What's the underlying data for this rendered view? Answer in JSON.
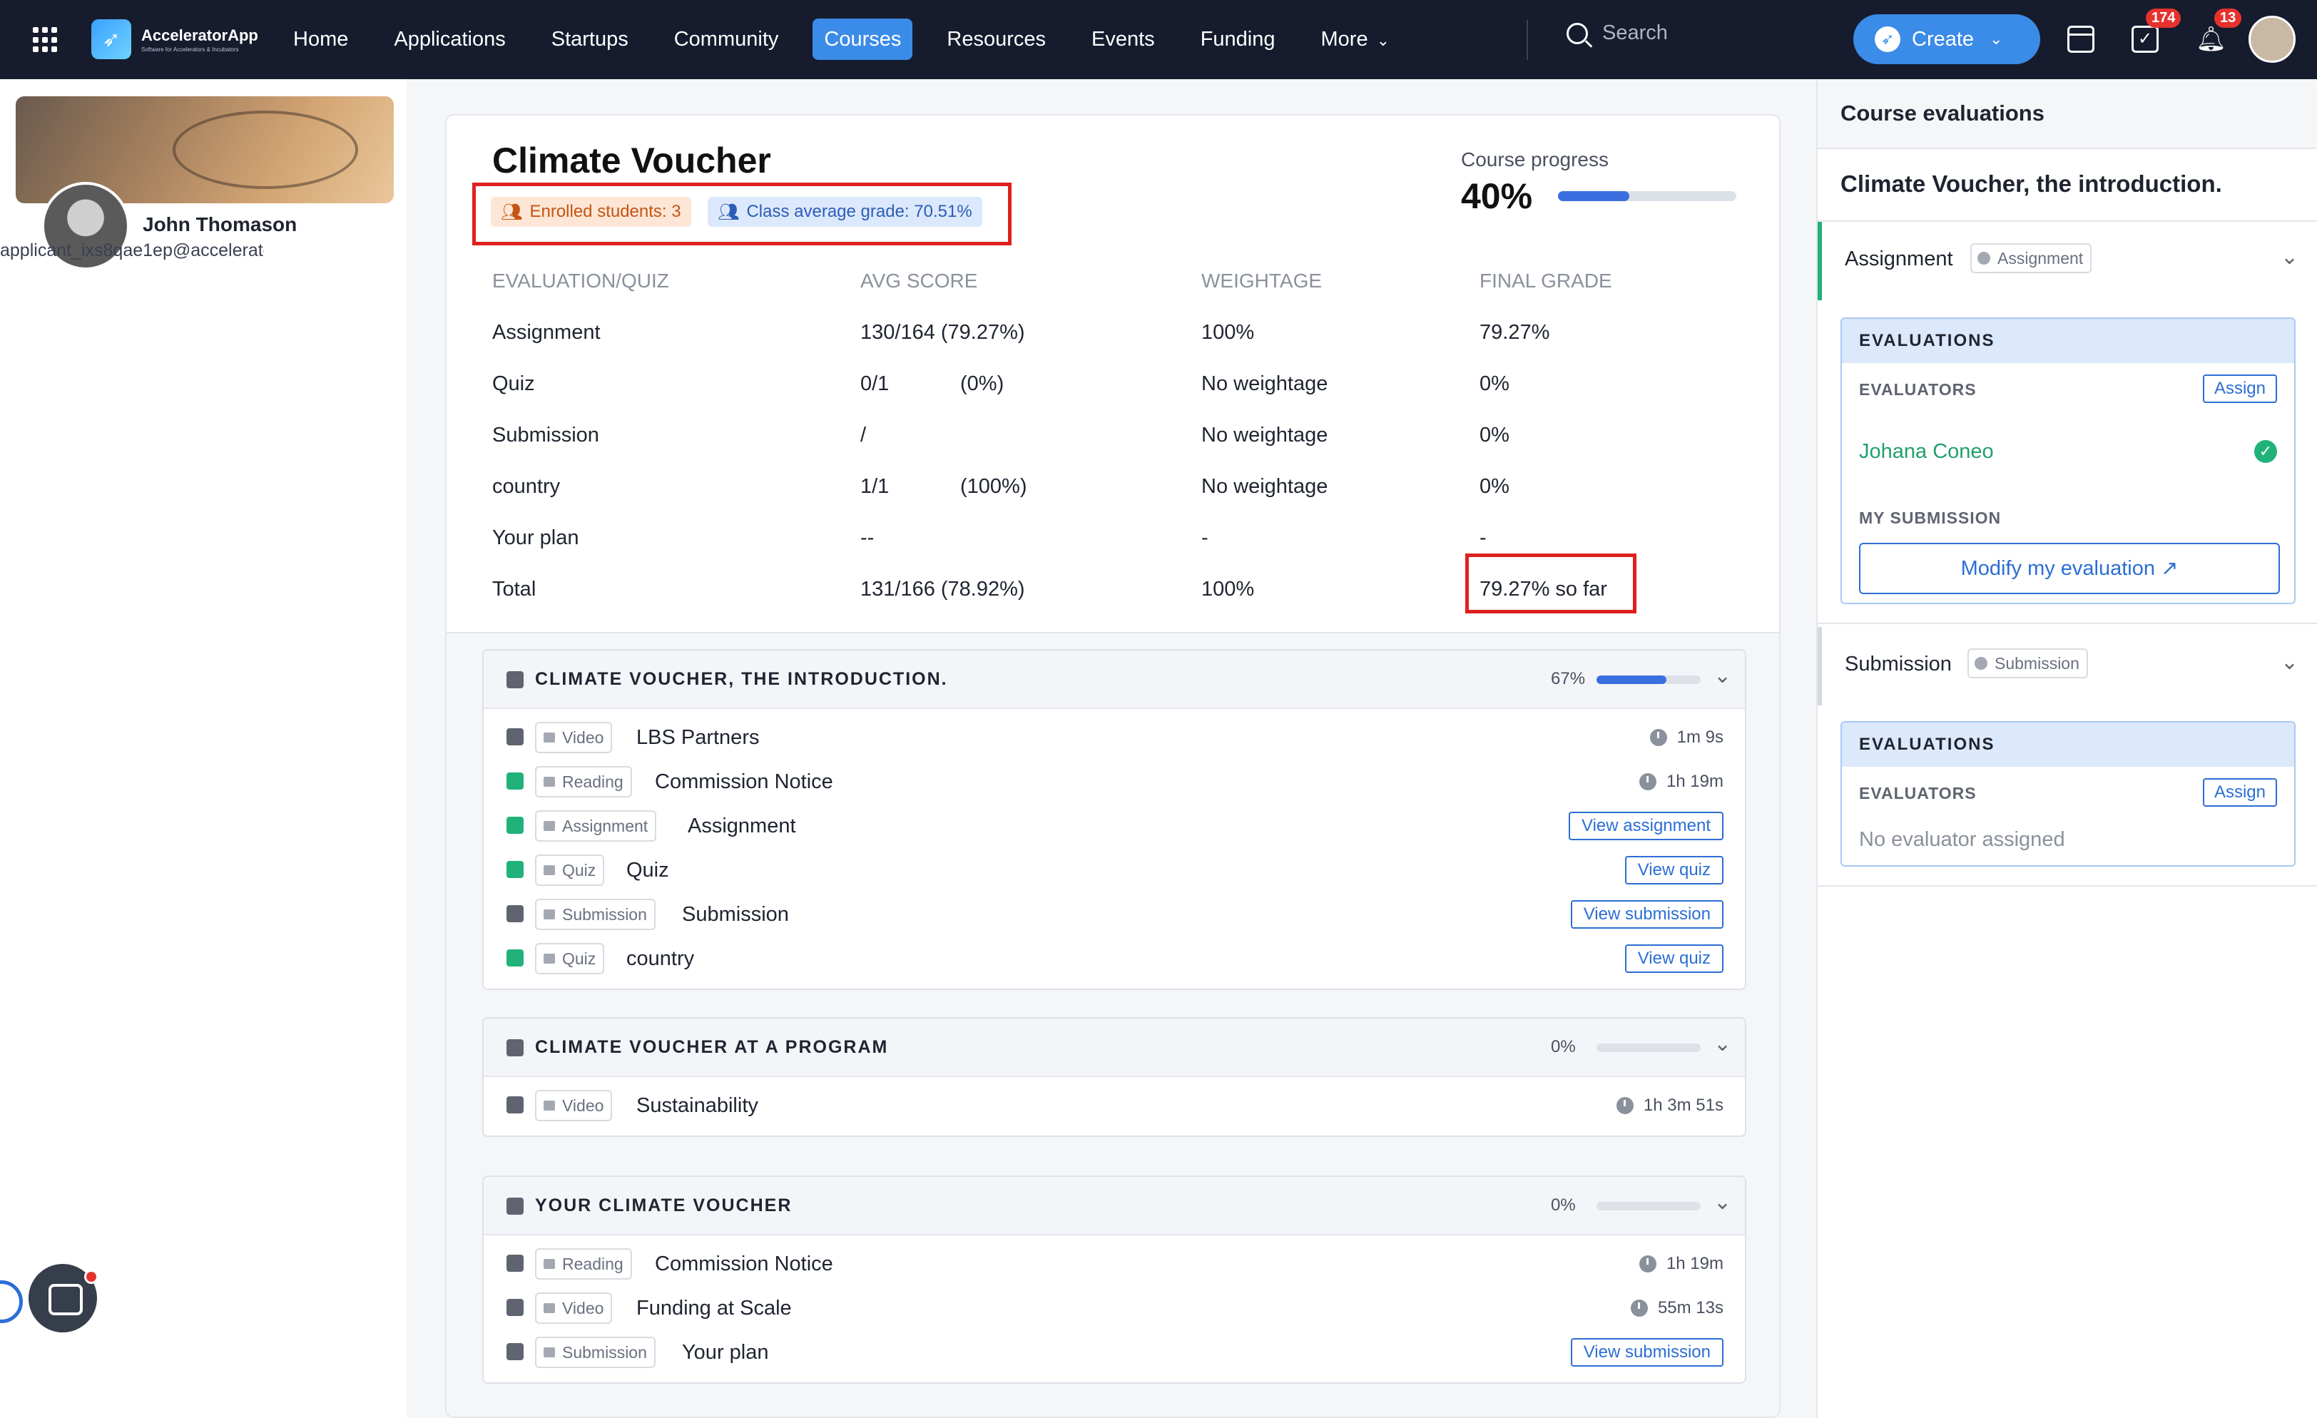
{
  "nav": {
    "logo_name": "AcceleratorApp",
    "logo_tagline": "Software for Accelerators & Incubators",
    "items": [
      "Home",
      "Applications",
      "Startups",
      "Community",
      "Courses",
      "Resources",
      "Events",
      "Funding",
      "More"
    ],
    "active": "Courses",
    "search_placeholder": "Search",
    "create_label": "Create",
    "tasks_badge": "174",
    "notifications_badge": "13"
  },
  "profile": {
    "name": "John Thomason",
    "email": "applicant_ixs8qae1ep@accelerato"
  },
  "course": {
    "title": "Climate Voucher",
    "enrolled": "Enrolled students: 3",
    "class_avg": "Class average grade: 70.51%",
    "progress_label": "Course progress",
    "progress_pct": "40%",
    "progress_value": 0.4
  },
  "grades": {
    "headers": [
      "EVALUATION/QUIZ",
      "AVG SCORE",
      "WEIGHTAGE",
      "FINAL GRADE"
    ],
    "rows": [
      {
        "name": "Assignment",
        "score": "130/164 (79.27%)",
        "score_pct": "",
        "weight": "100%",
        "final": "79.27%"
      },
      {
        "name": "Quiz",
        "score": "0/1",
        "score_pct": "(0%)",
        "weight": "No weightage",
        "final": "0%"
      },
      {
        "name": "Submission",
        "score": "/",
        "score_pct": "",
        "weight": "No weightage",
        "final": "0%"
      },
      {
        "name": "country",
        "score": "1/1",
        "score_pct": "(100%)",
        "weight": "No weightage",
        "final": "0%"
      },
      {
        "name": "Your plan",
        "score": "--",
        "score_pct": "",
        "weight": "-",
        "final": "-"
      },
      {
        "name": "Total",
        "score": "131/166 (78.92%)",
        "score_pct": "",
        "weight": "100%",
        "final": "79.27% so far"
      }
    ]
  },
  "modules": [
    {
      "title": "CLIMATE VOUCHER, THE INTRODUCTION.",
      "pct": "67%",
      "progress": 0.67,
      "lessons": [
        {
          "type": "Video",
          "title": "LBS Partners",
          "duration": "1m 9s",
          "done": false
        },
        {
          "type": "Reading",
          "title": "Commission Notice",
          "duration": "1h 19m",
          "done": true
        },
        {
          "type": "Assignment",
          "title": "Assignment",
          "button": "View assignment",
          "done": true
        },
        {
          "type": "Quiz",
          "title": "Quiz",
          "button": "View quiz",
          "done": true
        },
        {
          "type": "Submission",
          "title": "Submission",
          "button": "View submission",
          "done": false
        },
        {
          "type": "Quiz",
          "title": "country",
          "button": "View quiz",
          "done": true
        }
      ]
    },
    {
      "title": "CLIMATE VOUCHER AT A PROGRAM",
      "pct": "0%",
      "progress": 0,
      "lessons": [
        {
          "type": "Video",
          "title": "Sustainability",
          "duration": "1h 3m 51s",
          "done": false
        }
      ]
    },
    {
      "title": "YOUR CLIMATE VOUCHER",
      "pct": "0%",
      "progress": 0,
      "lessons": [
        {
          "type": "Reading",
          "title": "Commission Notice",
          "duration": "1h 19m",
          "done": false
        },
        {
          "type": "Video",
          "title": "Funding at Scale",
          "duration": "55m 13s",
          "done": false
        },
        {
          "type": "Submission",
          "title": "Your plan",
          "button": "View submission",
          "done": false
        }
      ]
    }
  ],
  "evaluations": {
    "panel_title": "Course evaluations",
    "subtitle": "Climate Voucher, the introduction.",
    "assignment": {
      "label": "Assignment",
      "chip": "Assignment",
      "box_title": "EVALUATIONS",
      "evaluators_label": "EVALUATORS",
      "assign_label": "Assign",
      "evaluator": "Johana Coneo",
      "my_submission_label": "MY SUBMISSION",
      "modify_label": "Modify my evaluation ↗"
    },
    "submission": {
      "label": "Submission",
      "chip": "Submission",
      "box_title": "EVALUATIONS",
      "evaluators_label": "EVALUATORS",
      "assign_label": "Assign",
      "empty": "No evaluator assigned"
    }
  },
  "colors": {
    "nav_bg": "#161c2d",
    "accent": "#3b8be8",
    "done": "#21b27a",
    "highlight_box": "#e02020"
  }
}
